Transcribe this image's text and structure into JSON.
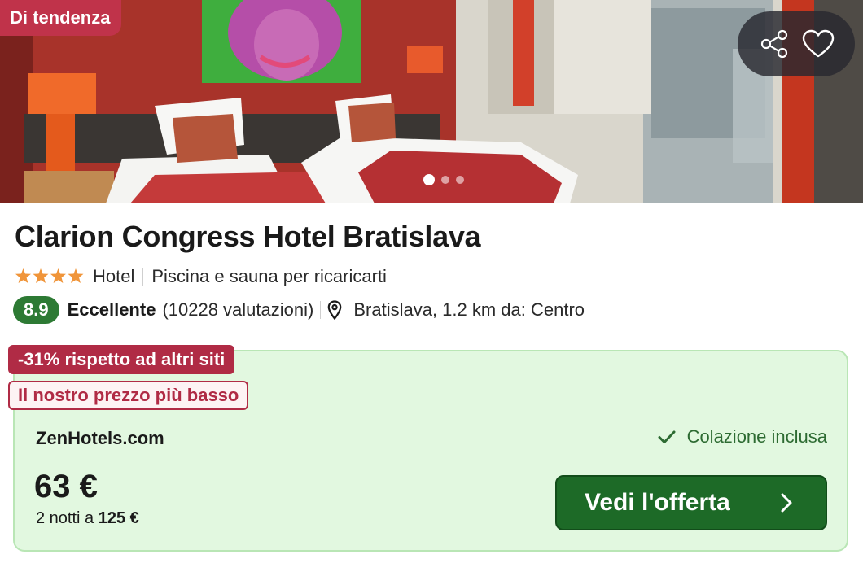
{
  "hero": {
    "badge": "Di tendenza",
    "share_icon": "share-icon",
    "favorite_icon": "heart-icon",
    "carousel_total": 3,
    "carousel_active": 1
  },
  "hotel": {
    "name": "Clarion Congress Hotel Bratislava",
    "stars": 4,
    "type": "Hotel",
    "tagline": "Piscina e sauna per ricaricarti",
    "score": "8.9",
    "rating_word": "Eccellente",
    "reviews": "(10228 valutazioni)",
    "location": "Bratislava, 1.2 km da: Centro"
  },
  "offer": {
    "discount": "-31% rispetto ad altri siti",
    "lowest": "Il nostro prezzo più basso",
    "provider": "ZenHotels.com",
    "breakfast": "Colazione inclusa",
    "price": "63 €",
    "nights_prefix": "2 notti a ",
    "nights_total": "125 €",
    "cta": "Vedi l'offerta"
  },
  "colors": {
    "badge_trending": "#c0334a",
    "score_bg": "#2d7a34",
    "offer_bg": "#e2f8e0",
    "offer_border": "#b9e6b5",
    "discount_bg": "#b02b45",
    "cta_bg": "#1d6a27",
    "star": "#f0953a"
  }
}
